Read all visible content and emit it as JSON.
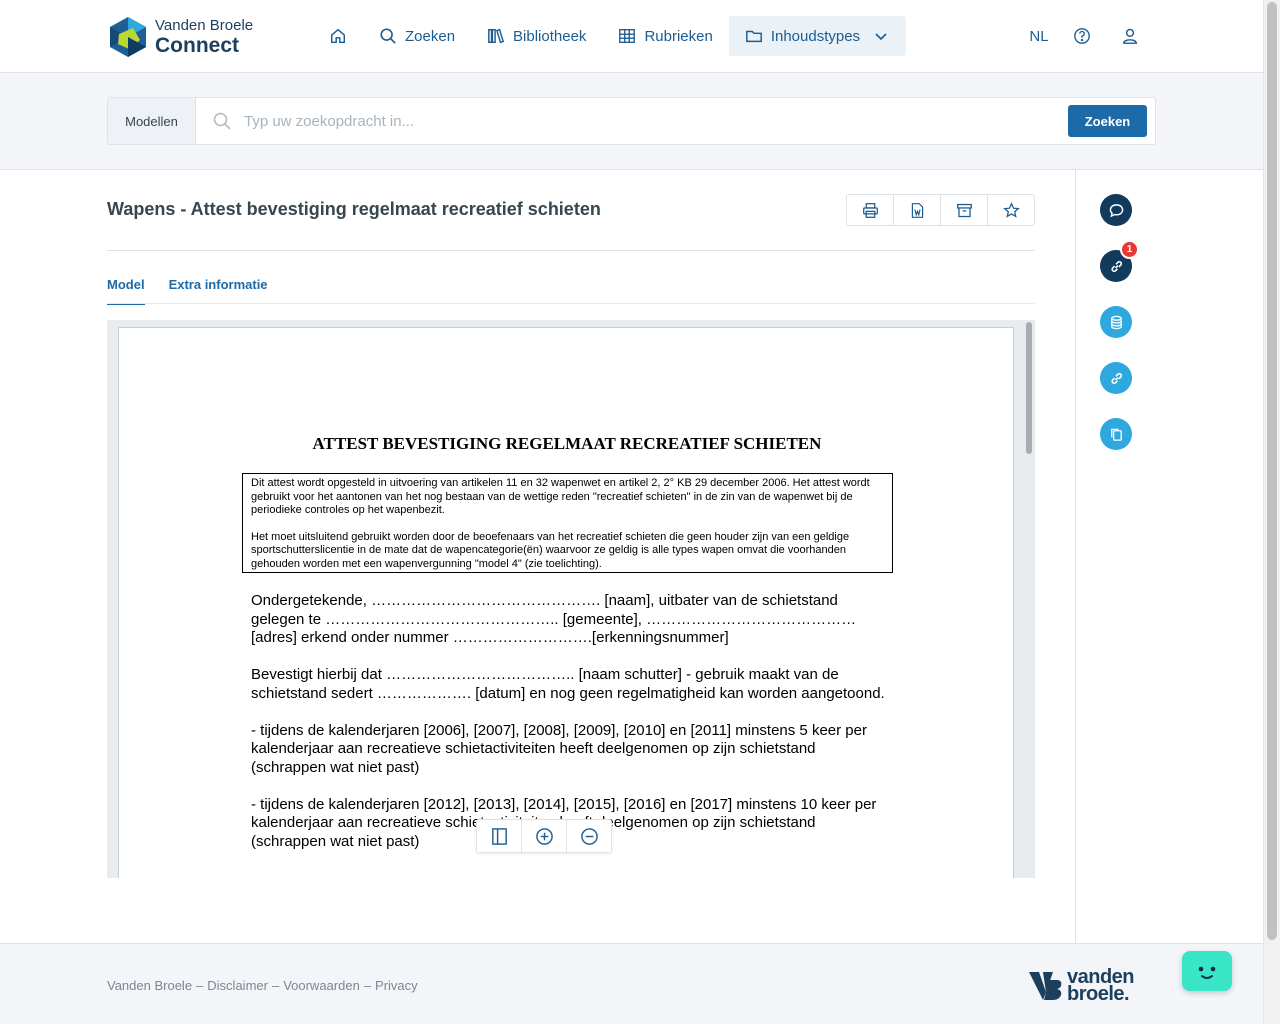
{
  "brand": {
    "top": "Vanden Broele",
    "bottom": "Connect"
  },
  "nav": {
    "home": "home",
    "search": "Zoeken",
    "library": "Bibliotheek",
    "sections": "Rubrieken",
    "content_types": "Inhoudstypes"
  },
  "header_right": {
    "language": "NL"
  },
  "search": {
    "scope": "Modellen",
    "placeholder": "Typ uw zoekopdracht in...",
    "button": "Zoeken"
  },
  "document": {
    "title": "Wapens - Attest bevestiging regelmaat recreatief schieten",
    "tabs": [
      "Model",
      "Extra informatie"
    ],
    "active_tab": "Model"
  },
  "pdf": {
    "heading": "ATTEST BEVESTIGING REGELMAAT RECREATIEF SCHIETEN",
    "box_p1": "Dit attest wordt opgesteld in uitvoering van artikelen 11 en 32 wapenwet en artikel 2, 2° KB 29 december 2006. Het attest wordt gebruikt voor het aantonen van het nog bestaan van de wettige reden \"recreatief schieten\" in de zin van de wapenwet bij de periodieke controles op het wapenbezit.",
    "box_p2": "Het moet uitsluitend gebruikt worden door de beoefenaars van het recreatief schieten die geen houder zijn van een geldige sportschutterslicentie in de mate dat de wapencategorie(ën) waarvoor ze geldig is alle types wapen omvat die voorhanden gehouden worden met een wapenvergunning \"model 4\" (zie toelichting).",
    "para1": "Ondergetekende, ………………………………………. [naam], uitbater van de schietstand gelegen te ……………………………………….. [gemeente], …………………………………… [adres] erkend onder nummer ……………………….[erkenningsnummer]",
    "para2": "Bevestigt hierbij dat ……………………………….. [naam schutter] - gebruik maakt van de schietstand sedert ………………. [datum] en nog geen regelmatigheid kan worden aangetoond.",
    "para3": "- tijdens de kalenderjaren [2006], [2007], [2008], [2009], [2010] en [2011] minstens 5 keer per kalenderjaar aan recreatieve schietactiviteiten heeft deelgenomen op zijn schietstand (schrappen wat niet past)",
    "para4": "- tijdens de kalenderjaren [2012], [2013], [2014], [2015], [2016] en [2017] minstens 10 keer per kalenderjaar aan recreatieve schietactiviteiten heeft deelgenomen op zijn schietstand (schrappen wat niet past)"
  },
  "side_actions": {
    "links_badge": "1"
  },
  "footer": {
    "links": [
      "Vanden Broele",
      "Disclaimer",
      "Voorwaarden",
      "Privacy"
    ],
    "separator": "–",
    "logo_line1": "vanden",
    "logo_line2": "broele."
  },
  "colors": {
    "primary": "#1d6aa8",
    "dark": "#123a5c",
    "light": "#2fa8e0",
    "accent_bot": "#38e5c6"
  }
}
